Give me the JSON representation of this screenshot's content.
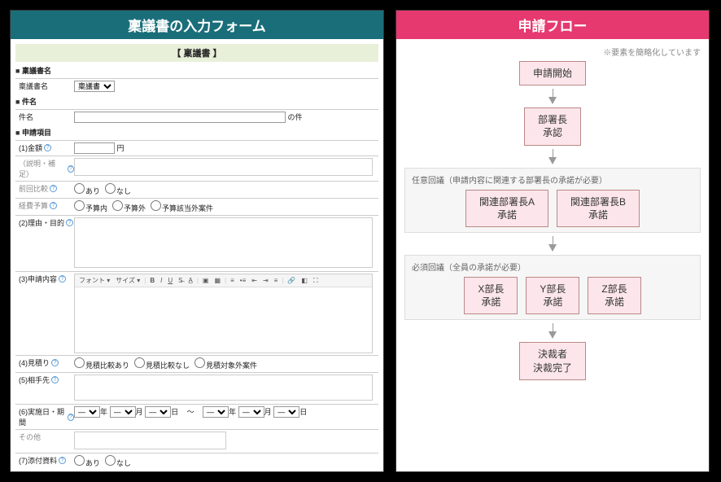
{
  "left": {
    "header": "稟議書の入力フォーム",
    "docTitle": "【 稟議書 】",
    "sect1": "稟議書名",
    "nameLabel": "稟議書名",
    "nameSelect": "稟議書",
    "sect2": "件名",
    "subjectLabel": "件名",
    "subjectSuffix": "の件",
    "sect3": "申請項目",
    "amountLabel": "(1)金額",
    "amountUnit": "円",
    "descLabel": "（説明・補足）",
    "compareLabel": "前回比較",
    "radioYes": "あり",
    "radioNo": "なし",
    "budgetLabel": "経費予算",
    "budget1": "予算内",
    "budget2": "予算外",
    "budget3": "予算該当外案件",
    "reasonLabel": "(2)理由・目的",
    "contentLabel": "(3)申請内容",
    "tbFont": "フォント",
    "tbSize": "サイズ",
    "quoteLabel": "(4)見積り",
    "quote1": "見積比較あり",
    "quote2": "見積比較なし",
    "quote3": "見積対象外案件",
    "vendorLabel": "(5)相手先",
    "dateLabel": "(6)実施日・期間",
    "otherLabel": "その他",
    "attachLabel": "(7)添付資料",
    "dd": "―",
    "yr": "年",
    "mo": "月",
    "dy": "日",
    "tilde": "～"
  },
  "right": {
    "header": "申請フロー",
    "note": "※要素を簡略化しています",
    "start": "申請開始",
    "mgr1": "部署長",
    "mgr2": "承認",
    "optTitle": "任意回議（申請内容に関連する部署長の承諾が必要）",
    "optA1": "関連部署長A",
    "optA2": "承諾",
    "optB1": "関連部署長B",
    "optB2": "承諾",
    "reqTitle": "必須回議（全員の承諾が必要）",
    "x1": "X部長",
    "x2": "承諾",
    "y1": "Y部長",
    "y2": "承諾",
    "z1": "Z部長",
    "z2": "承諾",
    "final1": "決裁者",
    "final2": "決裁完了"
  }
}
